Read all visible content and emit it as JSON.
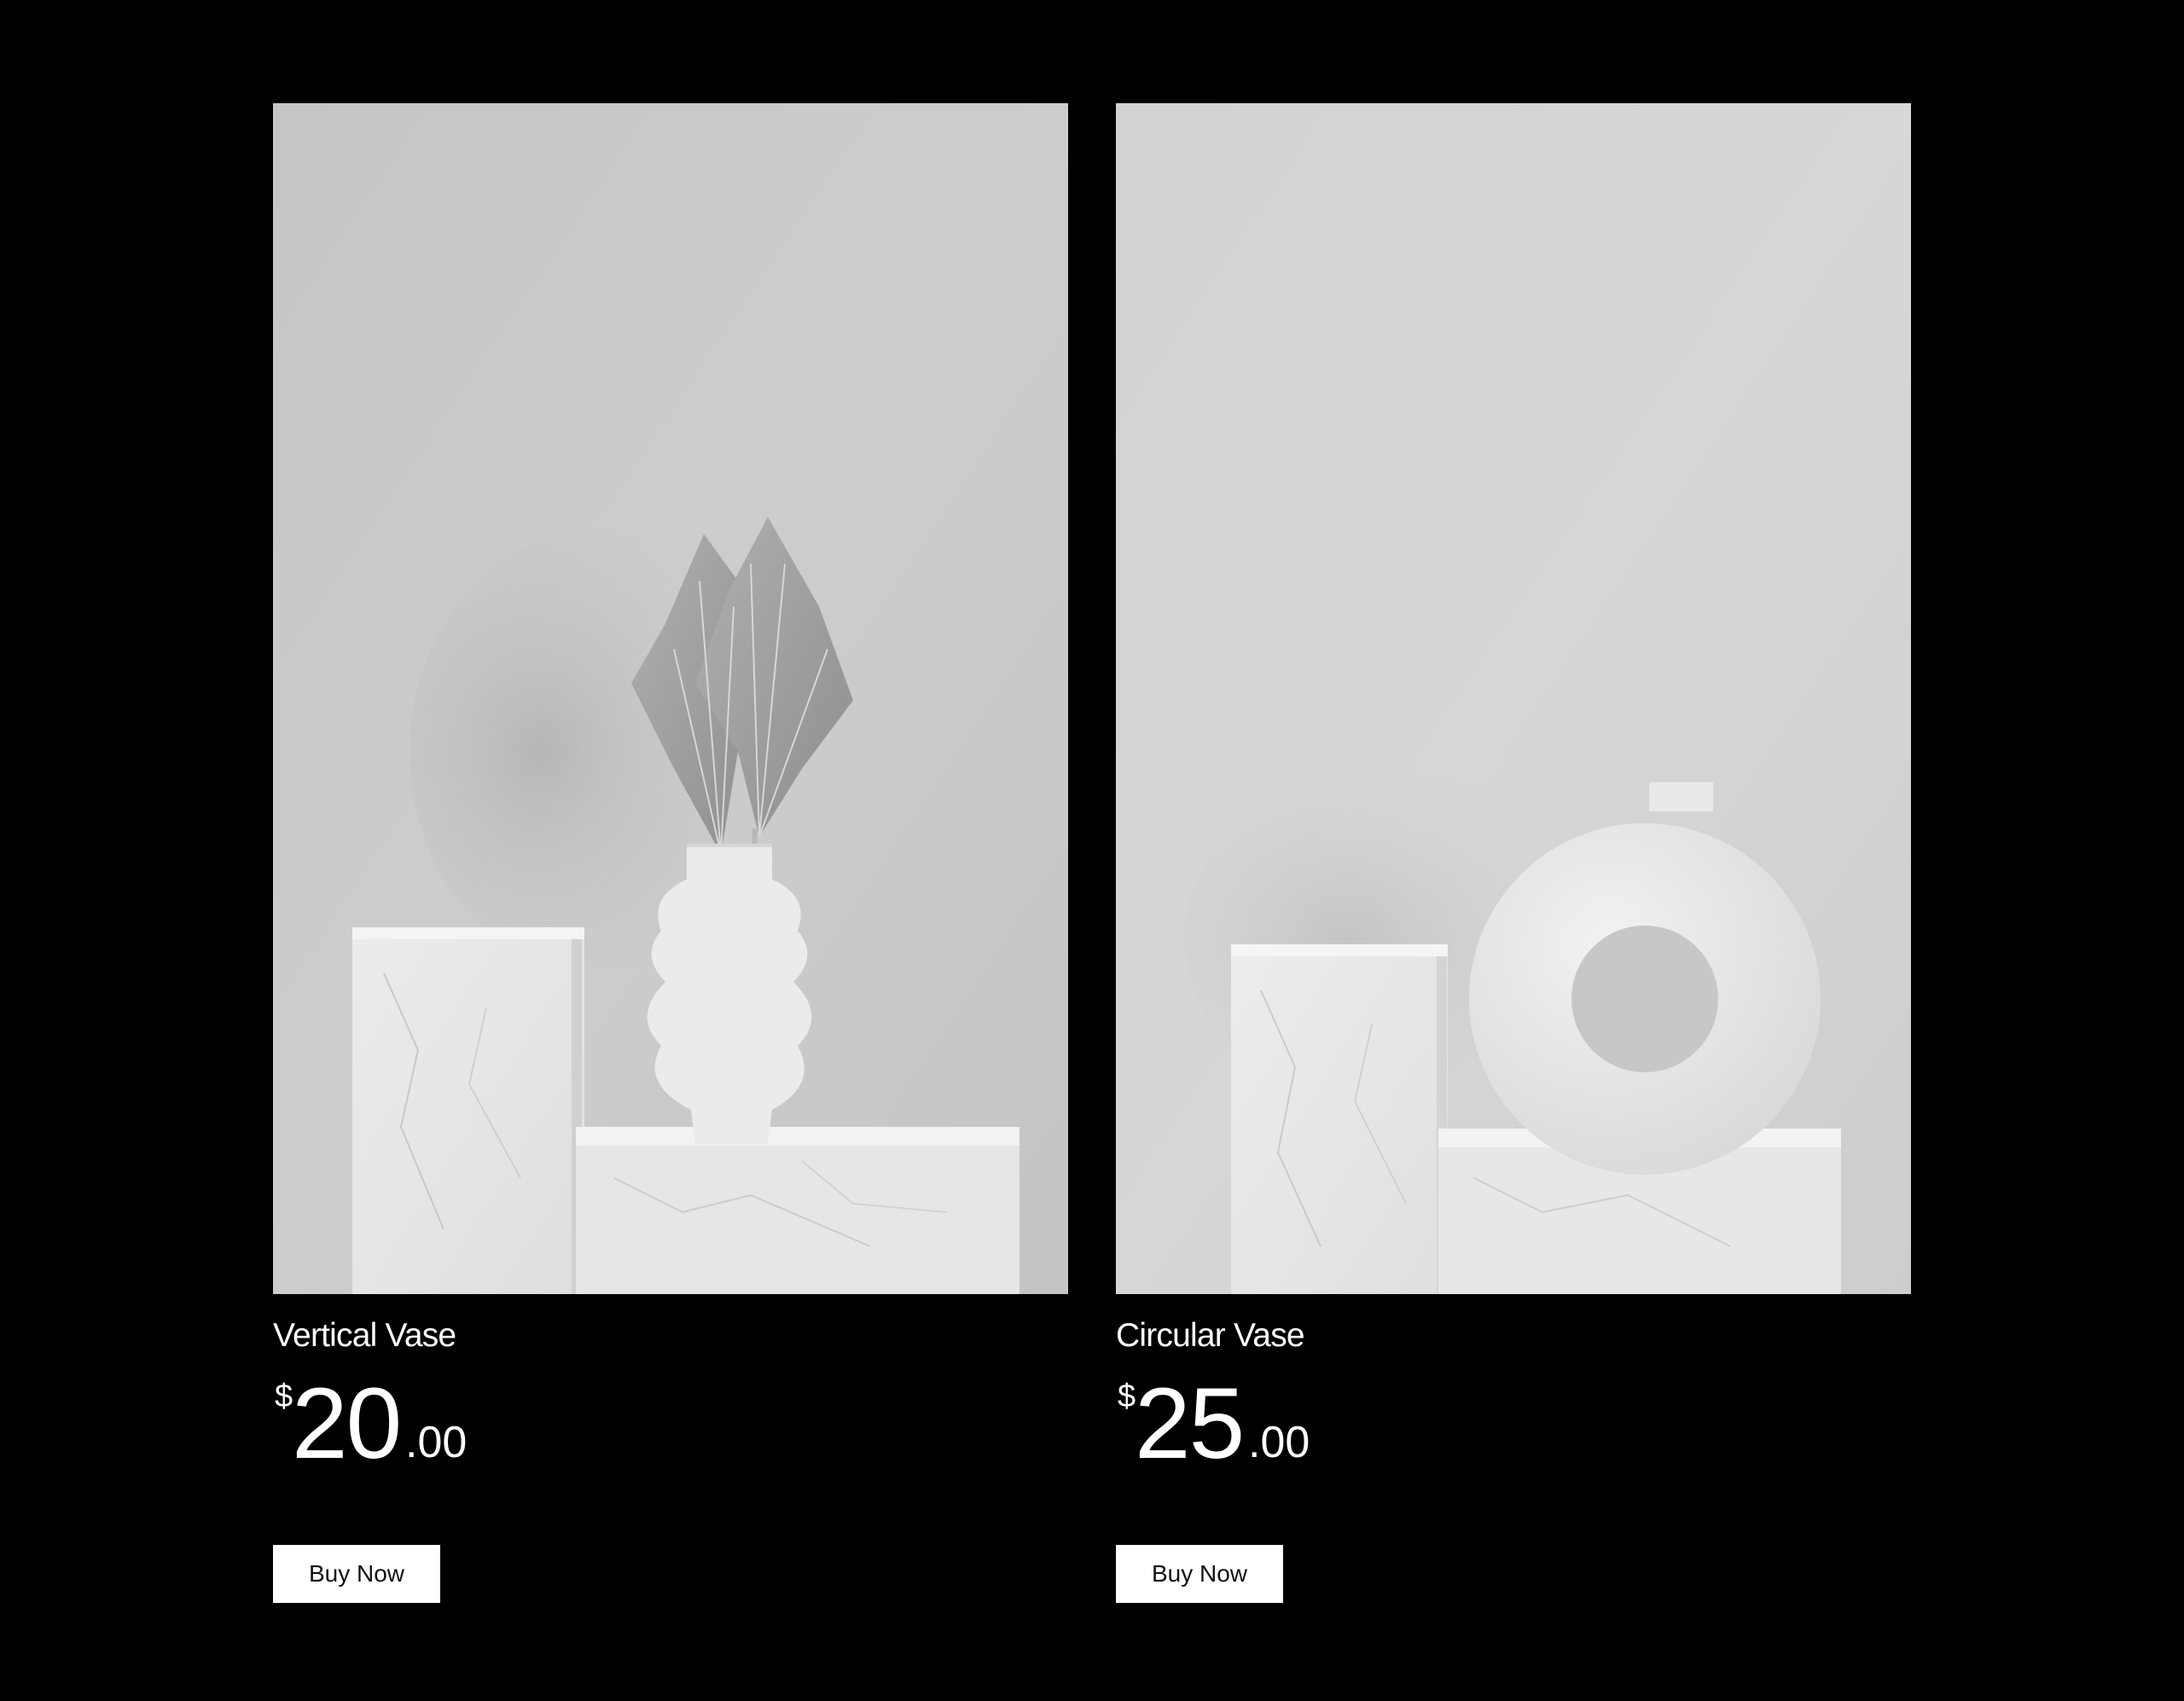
{
  "products": [
    {
      "name": "Vertical Vase",
      "currency": "$",
      "price_whole": "20",
      "price_cents": ".00",
      "button_label": "Buy Now",
      "image_icon": "vertical-vase-photo"
    },
    {
      "name": "Circular Vase",
      "currency": "$",
      "price_whole": "25",
      "price_cents": ".00",
      "button_label": "Buy Now",
      "image_icon": "circular-vase-photo"
    }
  ],
  "colors": {
    "background": "#000000",
    "text": "#ffffff",
    "button_bg": "#ffffff",
    "button_text": "#111111"
  }
}
